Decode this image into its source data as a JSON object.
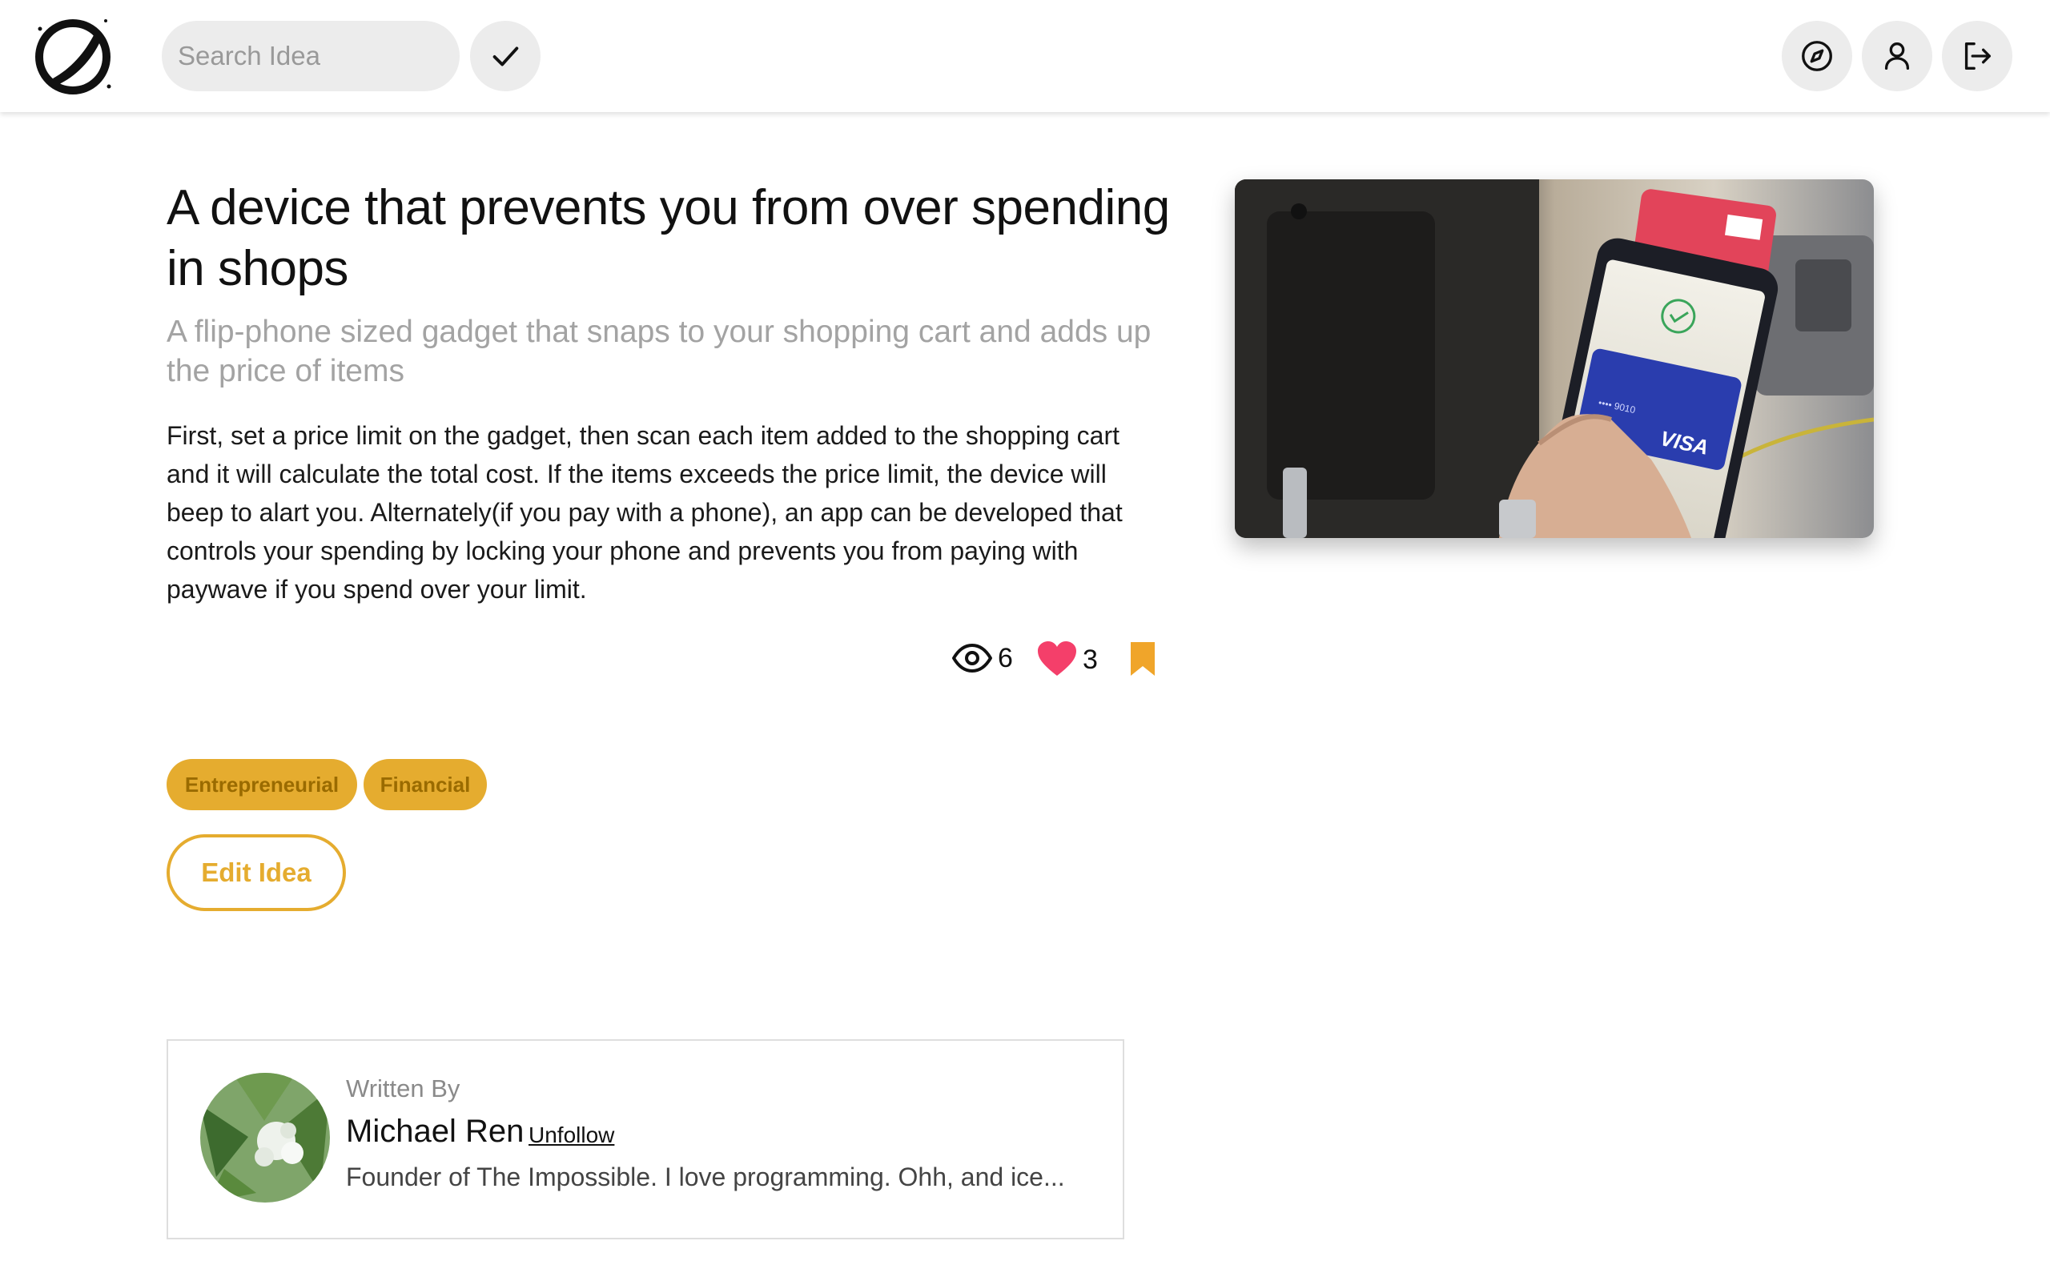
{
  "header": {
    "search": {
      "placeholder": "Search Idea",
      "value": ""
    },
    "logo_icon": "logo-slashed-circle-icon",
    "submit_icon": "check-icon",
    "actions": [
      {
        "name": "explore-button",
        "icon": "compass-icon"
      },
      {
        "name": "profile-button",
        "icon": "user-icon"
      },
      {
        "name": "logout-button",
        "icon": "logout-icon"
      }
    ]
  },
  "idea": {
    "title": "A device that prevents you from over spending in shops",
    "subtitle": "A flip-phone sized gadget that snaps to your shopping cart and adds up the price of items",
    "body": "First, set a price limit on the gadget, then scan each item added to the shopping cart and it will calculate the total cost. If the items exceeds the price limit, the device will beep to alart you. Alternately(if you pay with a phone), an app can be developed that controls your spending by locking your phone and prevents you from paying with paywave if you spend over your limit.",
    "image_alt": "Hand holding a phone with a Visa card over a payment terminal",
    "views": "6",
    "likes": "3",
    "views_icon": "eye-icon",
    "likes_icon": "heart-icon",
    "bookmark_icon": "bookmark-icon",
    "tags": [
      "Entrepreneurial",
      "Financial"
    ],
    "edit_label": "Edit Idea"
  },
  "author": {
    "written_by": "Written By",
    "name": "Michael Ren",
    "follow_label": "Unfollow",
    "bio": "Founder of The Impossible. I love programming. Ohh, and ice..."
  },
  "colors": {
    "accent": "#e5ac2f",
    "accent_text": "#9a6b00",
    "heart": "#f43f6a",
    "bookmark": "#f0a52a",
    "muted": "#a3a3a3"
  }
}
